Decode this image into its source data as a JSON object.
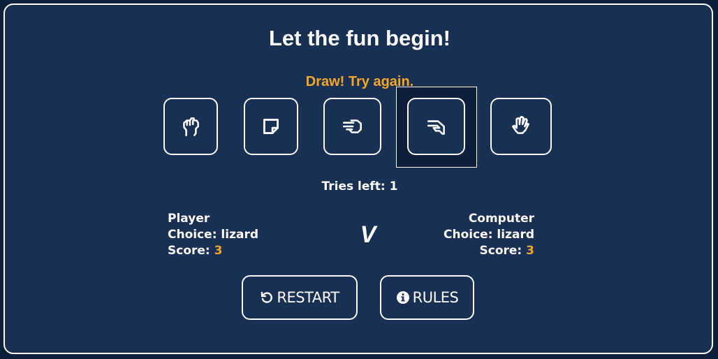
{
  "title": "Let the fun begin!",
  "result_message": "Draw! Try again.",
  "choices": [
    {
      "name": "rock",
      "icon": "hand-rock-icon"
    },
    {
      "name": "paper",
      "icon": "hand-paper-icon"
    },
    {
      "name": "scissors",
      "icon": "hand-scissors-icon"
    },
    {
      "name": "lizard",
      "icon": "hand-lizard-icon",
      "selected": true
    },
    {
      "name": "spock",
      "icon": "hand-spock-icon"
    }
  ],
  "tries": {
    "label": "Tries left:",
    "value": "1"
  },
  "player": {
    "name": "Player",
    "choice_label": "Choice:",
    "choice": "lizard",
    "score_label": "Score:",
    "score": "3"
  },
  "versus": "V",
  "computer": {
    "name": "Computer",
    "choice_label": "Choice:",
    "choice": "lizard",
    "score_label": "Score:",
    "score": "3"
  },
  "buttons": {
    "restart": "RESTART",
    "rules": "RULES"
  },
  "colors": {
    "background": "#0e1f3a",
    "panel": "#193055",
    "accent": "#f5a623"
  }
}
